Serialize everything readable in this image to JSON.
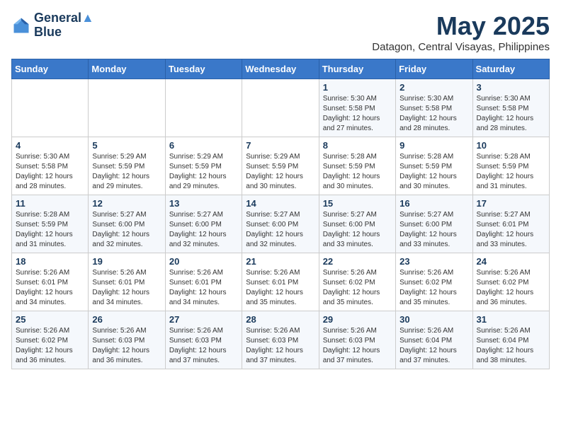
{
  "logo": {
    "line1": "General",
    "line2": "Blue"
  },
  "title": "May 2025",
  "location": "Datagon, Central Visayas, Philippines",
  "days_of_week": [
    "Sunday",
    "Monday",
    "Tuesday",
    "Wednesday",
    "Thursday",
    "Friday",
    "Saturday"
  ],
  "weeks": [
    [
      {
        "day": "",
        "info": ""
      },
      {
        "day": "",
        "info": ""
      },
      {
        "day": "",
        "info": ""
      },
      {
        "day": "",
        "info": ""
      },
      {
        "day": "1",
        "info": "Sunrise: 5:30 AM\nSunset: 5:58 PM\nDaylight: 12 hours\nand 27 minutes."
      },
      {
        "day": "2",
        "info": "Sunrise: 5:30 AM\nSunset: 5:58 PM\nDaylight: 12 hours\nand 28 minutes."
      },
      {
        "day": "3",
        "info": "Sunrise: 5:30 AM\nSunset: 5:58 PM\nDaylight: 12 hours\nand 28 minutes."
      }
    ],
    [
      {
        "day": "4",
        "info": "Sunrise: 5:30 AM\nSunset: 5:58 PM\nDaylight: 12 hours\nand 28 minutes."
      },
      {
        "day": "5",
        "info": "Sunrise: 5:29 AM\nSunset: 5:59 PM\nDaylight: 12 hours\nand 29 minutes."
      },
      {
        "day": "6",
        "info": "Sunrise: 5:29 AM\nSunset: 5:59 PM\nDaylight: 12 hours\nand 29 minutes."
      },
      {
        "day": "7",
        "info": "Sunrise: 5:29 AM\nSunset: 5:59 PM\nDaylight: 12 hours\nand 30 minutes."
      },
      {
        "day": "8",
        "info": "Sunrise: 5:28 AM\nSunset: 5:59 PM\nDaylight: 12 hours\nand 30 minutes."
      },
      {
        "day": "9",
        "info": "Sunrise: 5:28 AM\nSunset: 5:59 PM\nDaylight: 12 hours\nand 30 minutes."
      },
      {
        "day": "10",
        "info": "Sunrise: 5:28 AM\nSunset: 5:59 PM\nDaylight: 12 hours\nand 31 minutes."
      }
    ],
    [
      {
        "day": "11",
        "info": "Sunrise: 5:28 AM\nSunset: 5:59 PM\nDaylight: 12 hours\nand 31 minutes."
      },
      {
        "day": "12",
        "info": "Sunrise: 5:27 AM\nSunset: 6:00 PM\nDaylight: 12 hours\nand 32 minutes."
      },
      {
        "day": "13",
        "info": "Sunrise: 5:27 AM\nSunset: 6:00 PM\nDaylight: 12 hours\nand 32 minutes."
      },
      {
        "day": "14",
        "info": "Sunrise: 5:27 AM\nSunset: 6:00 PM\nDaylight: 12 hours\nand 32 minutes."
      },
      {
        "day": "15",
        "info": "Sunrise: 5:27 AM\nSunset: 6:00 PM\nDaylight: 12 hours\nand 33 minutes."
      },
      {
        "day": "16",
        "info": "Sunrise: 5:27 AM\nSunset: 6:00 PM\nDaylight: 12 hours\nand 33 minutes."
      },
      {
        "day": "17",
        "info": "Sunrise: 5:27 AM\nSunset: 6:01 PM\nDaylight: 12 hours\nand 33 minutes."
      }
    ],
    [
      {
        "day": "18",
        "info": "Sunrise: 5:26 AM\nSunset: 6:01 PM\nDaylight: 12 hours\nand 34 minutes."
      },
      {
        "day": "19",
        "info": "Sunrise: 5:26 AM\nSunset: 6:01 PM\nDaylight: 12 hours\nand 34 minutes."
      },
      {
        "day": "20",
        "info": "Sunrise: 5:26 AM\nSunset: 6:01 PM\nDaylight: 12 hours\nand 34 minutes."
      },
      {
        "day": "21",
        "info": "Sunrise: 5:26 AM\nSunset: 6:01 PM\nDaylight: 12 hours\nand 35 minutes."
      },
      {
        "day": "22",
        "info": "Sunrise: 5:26 AM\nSunset: 6:02 PM\nDaylight: 12 hours\nand 35 minutes."
      },
      {
        "day": "23",
        "info": "Sunrise: 5:26 AM\nSunset: 6:02 PM\nDaylight: 12 hours\nand 35 minutes."
      },
      {
        "day": "24",
        "info": "Sunrise: 5:26 AM\nSunset: 6:02 PM\nDaylight: 12 hours\nand 36 minutes."
      }
    ],
    [
      {
        "day": "25",
        "info": "Sunrise: 5:26 AM\nSunset: 6:02 PM\nDaylight: 12 hours\nand 36 minutes."
      },
      {
        "day": "26",
        "info": "Sunrise: 5:26 AM\nSunset: 6:03 PM\nDaylight: 12 hours\nand 36 minutes."
      },
      {
        "day": "27",
        "info": "Sunrise: 5:26 AM\nSunset: 6:03 PM\nDaylight: 12 hours\nand 37 minutes."
      },
      {
        "day": "28",
        "info": "Sunrise: 5:26 AM\nSunset: 6:03 PM\nDaylight: 12 hours\nand 37 minutes."
      },
      {
        "day": "29",
        "info": "Sunrise: 5:26 AM\nSunset: 6:03 PM\nDaylight: 12 hours\nand 37 minutes."
      },
      {
        "day": "30",
        "info": "Sunrise: 5:26 AM\nSunset: 6:04 PM\nDaylight: 12 hours\nand 37 minutes."
      },
      {
        "day": "31",
        "info": "Sunrise: 5:26 AM\nSunset: 6:04 PM\nDaylight: 12 hours\nand 38 minutes."
      }
    ]
  ]
}
